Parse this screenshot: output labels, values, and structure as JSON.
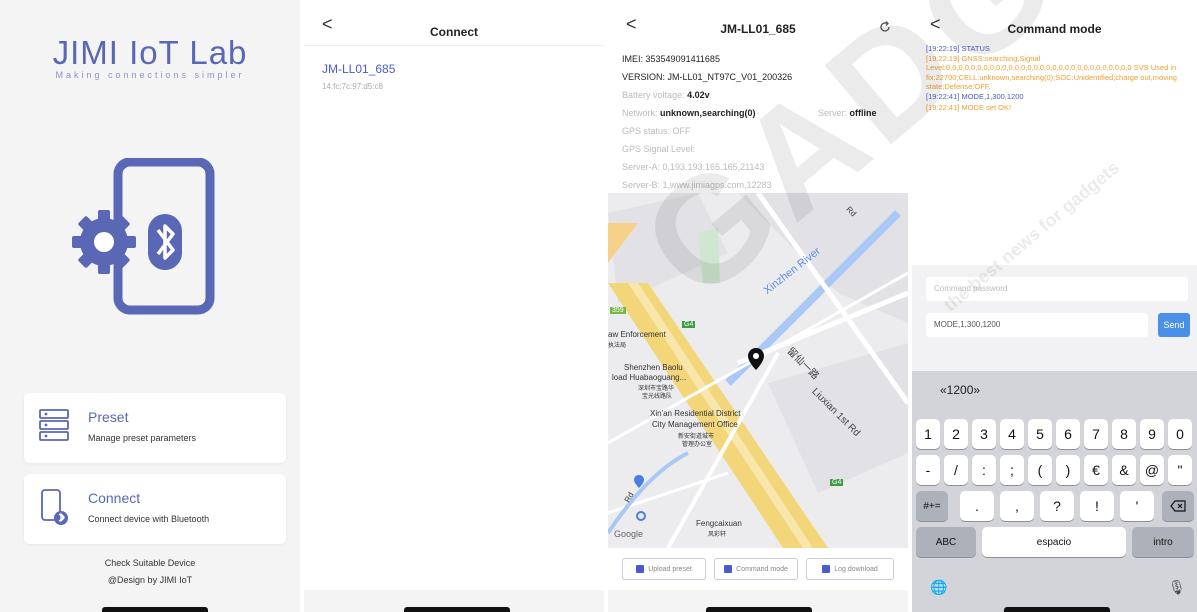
{
  "splash": {
    "title": "JIMI IoT Lab",
    "subtitle": "Making connections simpler",
    "preset_title": "Preset",
    "preset_desc": "Manage preset parameters",
    "connect_title": "Connect",
    "connect_desc": "Connect device with Bluetooth",
    "footer_check": "Check Suitable Device",
    "footer_design": "@Design by JIMI IoT"
  },
  "connect": {
    "back": "<",
    "title": "Connect",
    "device_name": "JM-LL01_685",
    "device_mac": "14:fc:7c:97:d5:c8"
  },
  "device": {
    "back": "<",
    "title": "JM-LL01_685",
    "imei_label": "IMEI:",
    "imei": "353549091411685",
    "version_label": "VERSION:",
    "version": "JM-LL01_NT97C_V01_200326",
    "battery_label": "Battery voltage:",
    "battery": "4.02v",
    "network_label": "Network:",
    "network": "unknown,searching(0)",
    "server_label": "Server:",
    "server": "offline",
    "gps_status": "GPS status: OFF",
    "gps_signal": "GPS Signal Level:",
    "server_a": "Server-A: 0,193.193.165.165,21143",
    "server_b": "Server-B: 1,www.jimiagps.com,12283",
    "map": {
      "law": "aw Enforcement",
      "law_cn": "执法局",
      "baolu1": "Shenzhen Baolu",
      "baolu2": "load Huabaoguang...",
      "baolu_cn1": "深圳市宝路华",
      "baolu_cn2": "宝光线路队",
      "xinan1": "Xin'an Residential District",
      "xinan2": "City Management Office",
      "xinan_cn1": "新安街道城市",
      "xinan_cn2": "管理办公室",
      "river": "Xinzhen River",
      "street": "Liuxian 1st Rd",
      "street_cn": "留仙一路",
      "feng": "Fengcaixuan",
      "feng_cn": "风彩轩",
      "google": "Google",
      "badge_g4": "G4",
      "badge_359": "359",
      "rd": "Rd"
    },
    "btn_upload": "Upload preset",
    "btn_command": "Command mode",
    "btn_log": "Log download"
  },
  "command": {
    "back": "<",
    "title": "Command mode",
    "log": [
      {
        "cls": "l-blue",
        "text": "[19:22:19] STATUS"
      },
      {
        "cls": "l-orange",
        "text": "[19:22:19] GNSS:searching,Signal Level:0,0,0,0,0,0,0,0,0,0,0,0,0,0,0,0,0,0,0,0,0,0,0,0,0,0,0,0,0,0 SVS Used in fix:22700;CELL:unknown,searching(0);SOC:Unidentified;charge out,moving state;Defense:OFF."
      },
      {
        "cls": "l-blue",
        "text": "[19:22:41] MODE,1,300,1200"
      },
      {
        "cls": "l-orange",
        "text": "[19:22:41] MODE set OK!"
      }
    ],
    "placeholder": "Command password",
    "input_value": "MODE,1,300,1200",
    "send": "Send",
    "suggestion": "«1200»",
    "row1": [
      "1",
      "2",
      "3",
      "4",
      "5",
      "6",
      "7",
      "8",
      "9",
      "0"
    ],
    "row2": [
      "-",
      "/",
      ":",
      ";",
      "(",
      ")",
      "€",
      "&",
      "@",
      "\""
    ],
    "row3": [
      ".",
      ",",
      "?",
      "!",
      "'"
    ],
    "more": "#+=",
    "abc": "ABC",
    "space": "espacio",
    "intro": "intro",
    "globe": "🌐",
    "mic": "🎙"
  },
  "watermark": {
    "text": "GADGETS",
    "small": "the best news for gadgets"
  },
  "colors": {
    "accent": "#5a67b5",
    "link": "#4a5bd0",
    "send": "#4a8fe8",
    "log_orange": "#f0a030"
  }
}
